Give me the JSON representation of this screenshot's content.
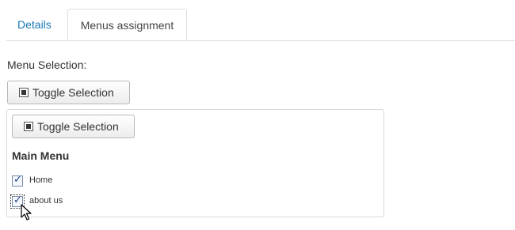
{
  "tabs": [
    {
      "label": "Details",
      "active": false
    },
    {
      "label": "Menus assignment",
      "active": true
    }
  ],
  "menu_selection": {
    "label": "Menu Selection:",
    "toggle_label": "Toggle Selection"
  },
  "panel": {
    "toggle_label": "Toggle Selection",
    "menu_title": "Main Menu",
    "items": [
      {
        "label": "Home",
        "checked": true
      },
      {
        "label": "about us",
        "checked": true
      }
    ]
  },
  "icons": {
    "toggle": "toggle-square-icon",
    "check": "checkmark-icon",
    "cursor": "mouse-pointer-icon"
  },
  "colors": {
    "link": "#1a7ab8",
    "check": "#1f3f86",
    "border": "#dddddd"
  }
}
